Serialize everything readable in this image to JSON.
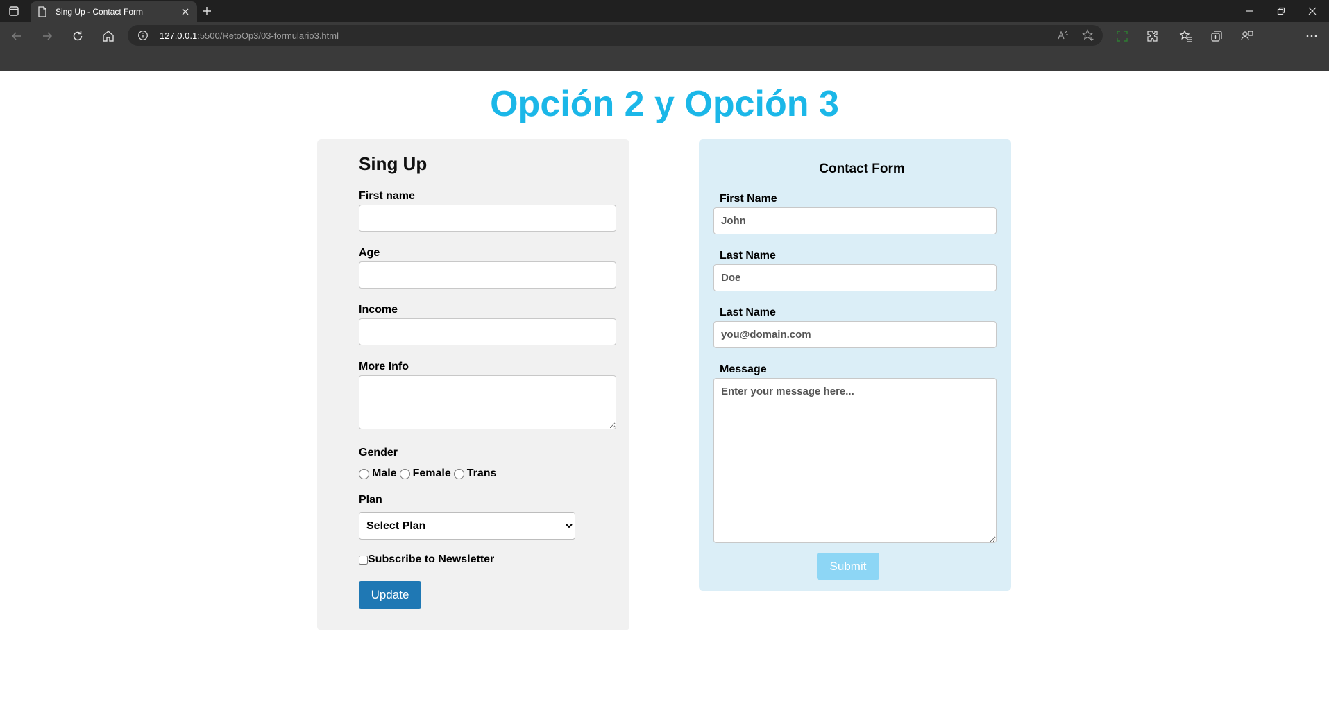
{
  "browser": {
    "tab_title": "Sing Up - Contact Form",
    "url_host": "127.0.0.1",
    "url_rest": ":5500/RetoOp3/03-formulario3.html"
  },
  "page": {
    "title": "Opción 2 y Opción 3"
  },
  "signup": {
    "heading": "Sing Up",
    "first_name_label": "First name",
    "age_label": "Age",
    "income_label": "Income",
    "more_info_label": "More Info",
    "gender_label": "Gender",
    "gender_options": [
      "Male",
      "Female",
      "Trans"
    ],
    "plan_label": "Plan",
    "plan_selected": "Select Plan",
    "newsletter_label": "Subscribe to Newsletter",
    "update_button": "Update"
  },
  "contact": {
    "heading": "Contact Form",
    "first_name_label": "First Name",
    "first_name_placeholder": "John",
    "last_name_label": "Last Name",
    "last_name_placeholder": "Doe",
    "email_label": "Last Name",
    "email_placeholder": "you@domain.com",
    "message_label": "Message",
    "message_placeholder": "Enter your message here...",
    "submit_button": "Submit"
  },
  "colors": {
    "title": "#1bb7e8",
    "update_button": "#1f78b4",
    "submit_button": "#8dd6f5",
    "contact_bg": "#dbeef7",
    "signup_bg": "#f1f1f1"
  }
}
